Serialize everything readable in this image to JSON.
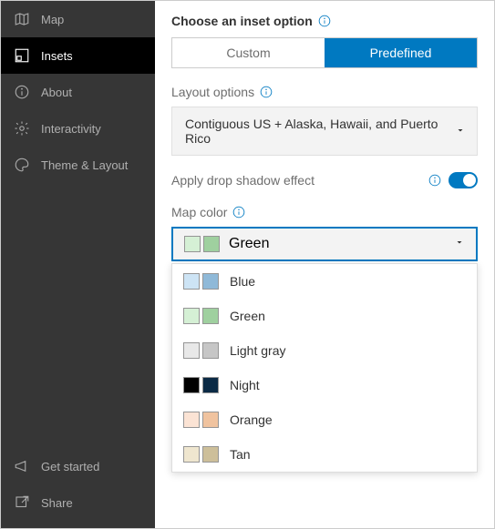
{
  "sidebar": {
    "top": [
      {
        "label": "Map",
        "icon": "map"
      },
      {
        "label": "Insets",
        "icon": "insets"
      },
      {
        "label": "About",
        "icon": "about"
      },
      {
        "label": "Interactivity",
        "icon": "interactivity"
      },
      {
        "label": "Theme & Layout",
        "icon": "theme"
      }
    ],
    "bottom": [
      {
        "label": "Get started",
        "icon": "megaphone"
      },
      {
        "label": "Share",
        "icon": "share"
      }
    ]
  },
  "main": {
    "choose_label": "Choose an inset option",
    "custom_label": "Custom",
    "predefined_label": "Predefined",
    "layout_label": "Layout options",
    "layout_value": "Contiguous US + Alaska, Hawaii, and Puerto Rico",
    "shadow_label": "Apply drop shadow effect",
    "mapcolor_label": "Map color",
    "selected_color": "Green",
    "selected_swatches": [
      "#d5f0d5",
      "#9fd09f"
    ],
    "color_options": [
      {
        "label": "Blue",
        "swatches": [
          "#cde4f5",
          "#8fb9d8"
        ]
      },
      {
        "label": "Green",
        "swatches": [
          "#d5f0d5",
          "#9fd09f"
        ]
      },
      {
        "label": "Light gray",
        "swatches": [
          "#e8e8e8",
          "#c6c6c6"
        ]
      },
      {
        "label": "Night",
        "swatches": [
          "#000000",
          "#0b2a45"
        ]
      },
      {
        "label": "Orange",
        "swatches": [
          "#fbe3d4",
          "#f0c39f"
        ]
      },
      {
        "label": "Tan",
        "swatches": [
          "#efe6cf",
          "#cdbf9a"
        ]
      }
    ]
  }
}
